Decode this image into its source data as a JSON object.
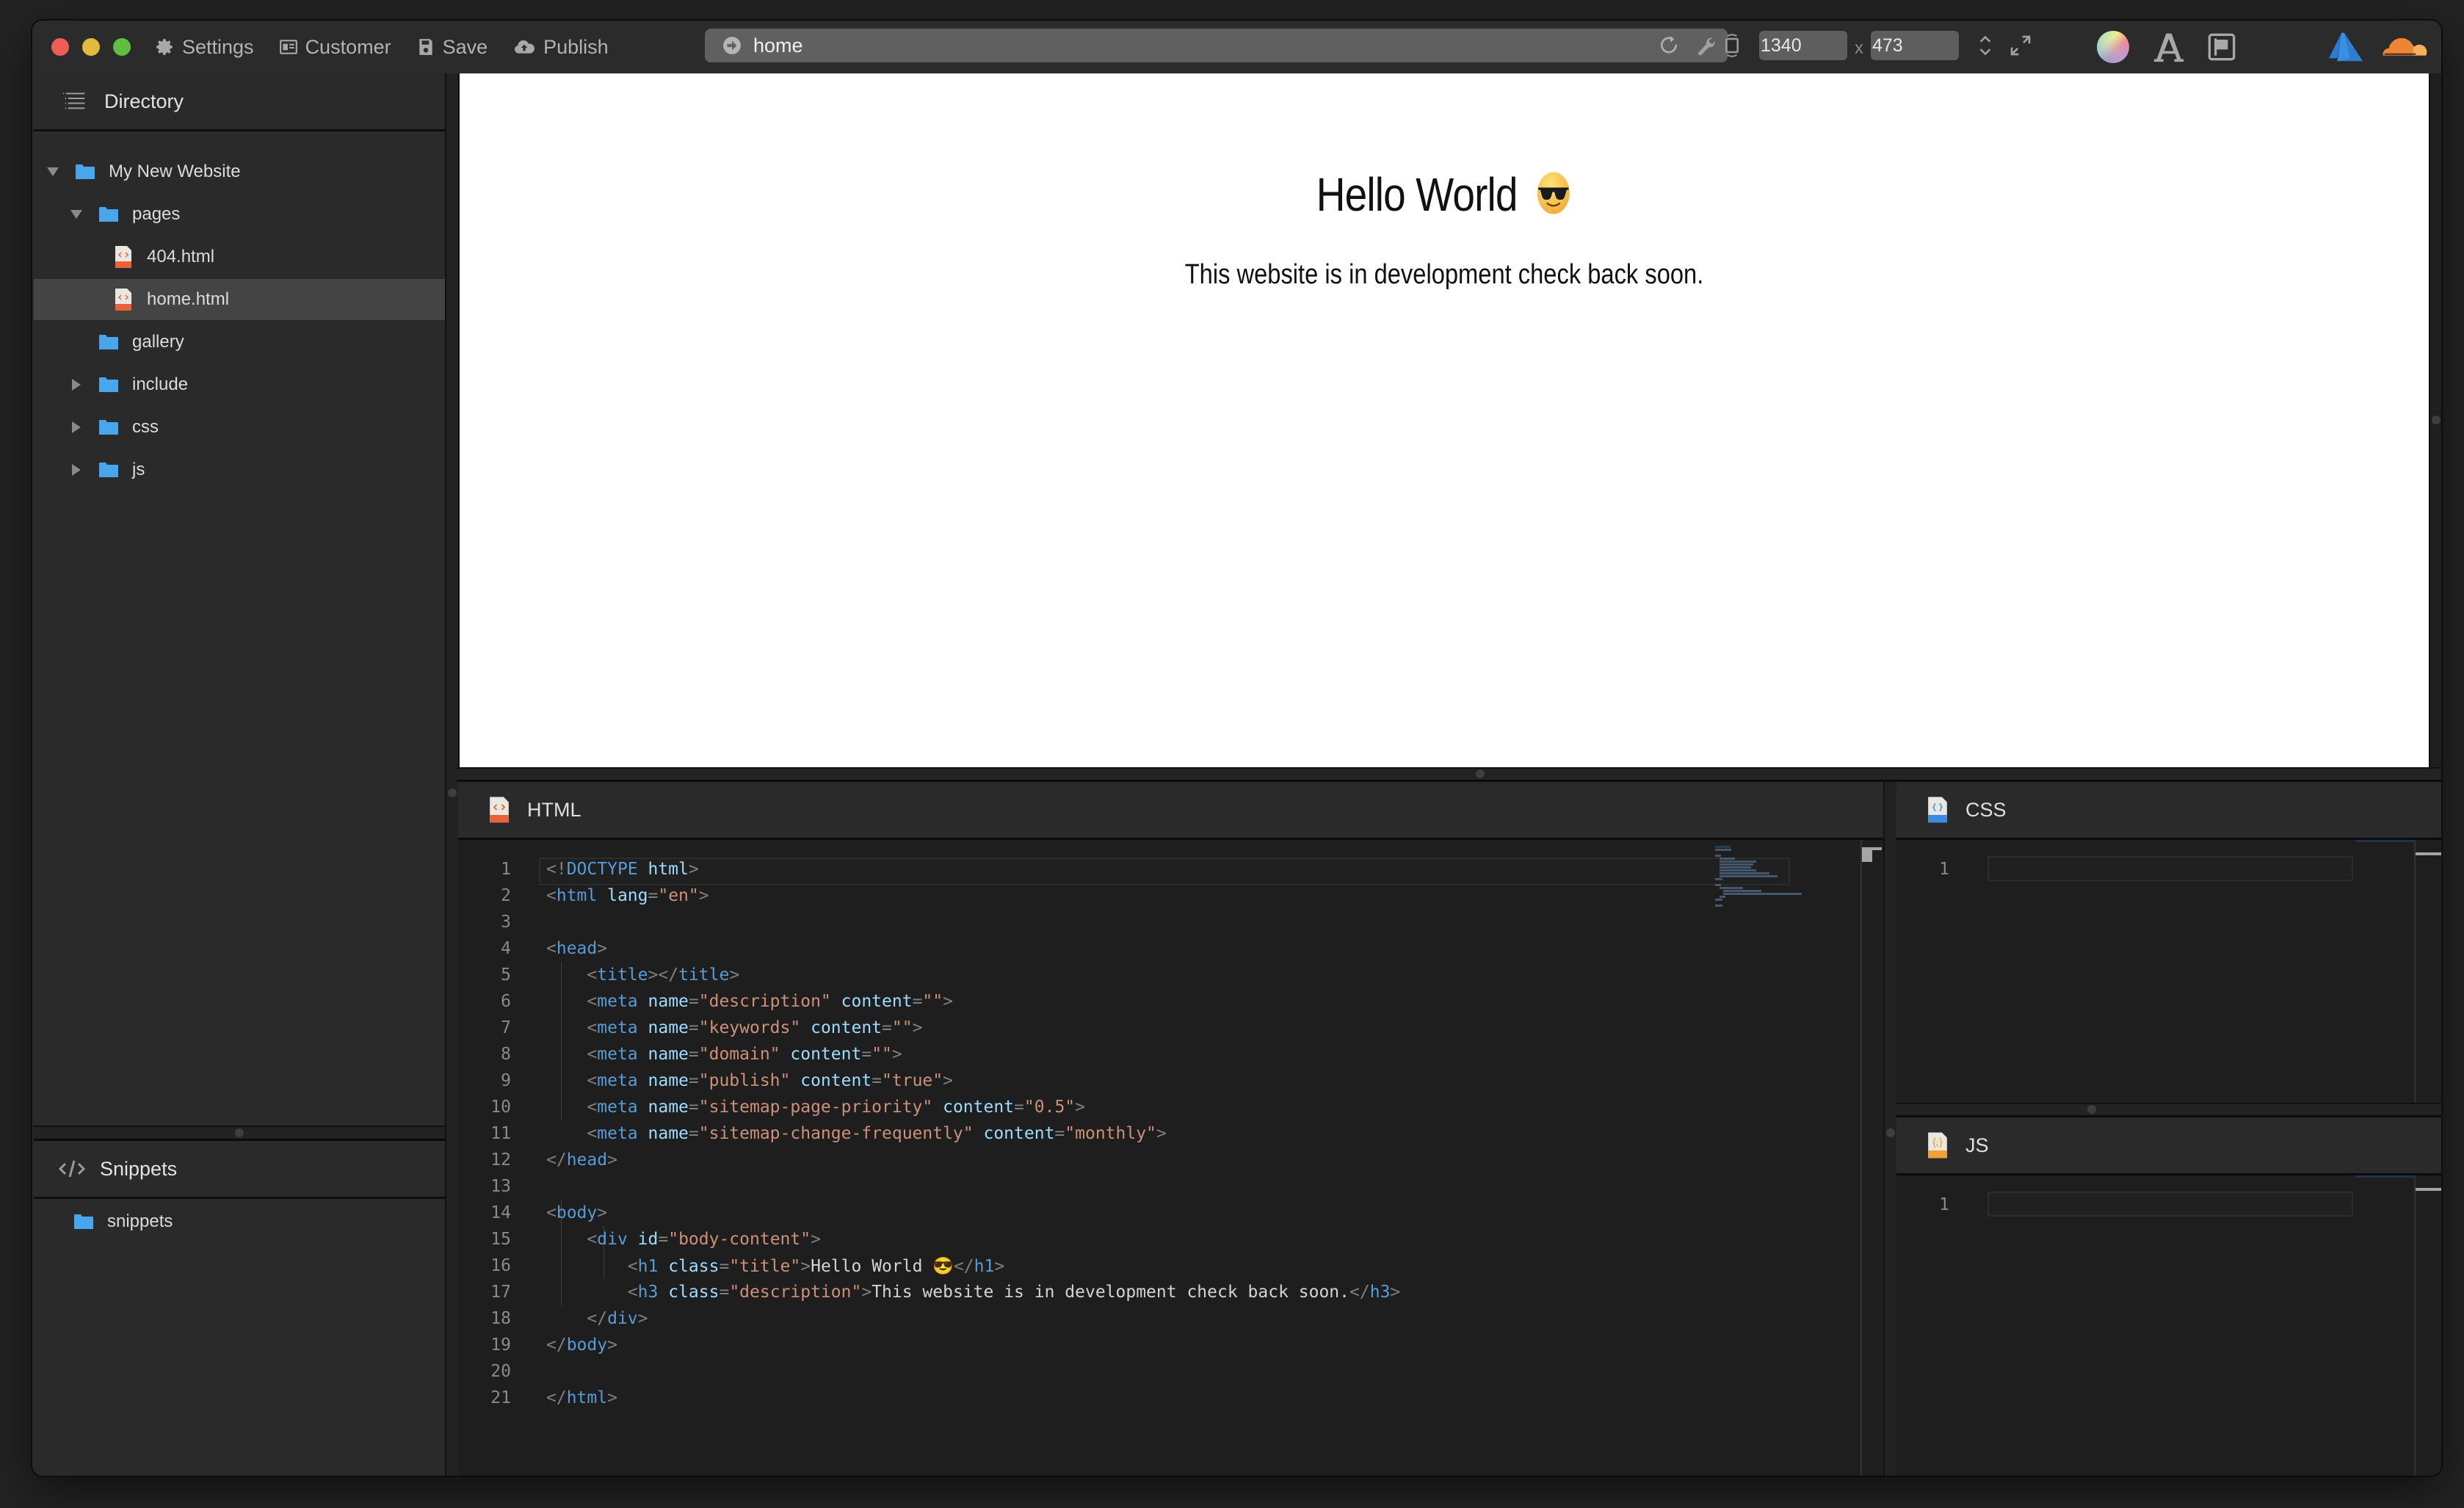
{
  "window": {
    "traffic_lights": {
      "close": "#ee5e56",
      "minimize": "#e1bb3d",
      "maximize": "#5fc040"
    }
  },
  "toolbar": {
    "buttons": [
      {
        "label": "Settings",
        "icon": "gear-icon"
      },
      {
        "label": "Customer",
        "icon": "id-card-icon"
      },
      {
        "label": "Save",
        "icon": "floppy-disk-icon"
      },
      {
        "label": "Publish",
        "icon": "cloud-upload-icon"
      }
    ],
    "url": {
      "value": "home",
      "icon": "arrow-circle-icon",
      "right_icons": [
        "reload-icon",
        "wrench-icon"
      ]
    },
    "viewport": {
      "width": "1340",
      "separator": "x",
      "height": "473"
    },
    "right_icons": [
      "rotate-device-icon",
      "stepper-icon",
      "expand-icon",
      "color-wheel-icon",
      "font-icon",
      "flag-icon",
      "azure-icon",
      "cloudflare-icon"
    ]
  },
  "sidebar": {
    "directory": {
      "title": "Directory",
      "items": [
        {
          "label": "My New Website",
          "type": "folder",
          "expanded": true,
          "level": 0
        },
        {
          "label": "pages",
          "type": "folder",
          "expanded": true,
          "level": 1
        },
        {
          "label": "404.html",
          "type": "file",
          "level": 2
        },
        {
          "label": "home.html",
          "type": "file",
          "level": 2,
          "selected": true
        },
        {
          "label": "gallery",
          "type": "folder",
          "level": 1
        },
        {
          "label": "include",
          "type": "folder",
          "expanded": false,
          "level": 1
        },
        {
          "label": "css",
          "type": "folder",
          "expanded": false,
          "level": 1
        },
        {
          "label": "js",
          "type": "folder",
          "expanded": false,
          "level": 1
        }
      ]
    },
    "snippets": {
      "title": "Snippets",
      "items": [
        {
          "label": "snippets",
          "type": "folder"
        }
      ]
    }
  },
  "preview": {
    "heading": "Hello World",
    "heading_emoji": "smiling-face-with-sunglasses",
    "description": "This website is in development check back soon."
  },
  "editors": {
    "html": {
      "title": "HTML",
      "lines": [
        "<!DOCTYPE html>",
        "<html lang=\"en\">",
        "",
        "<head>",
        "    <title></title>",
        "    <meta name=\"description\" content=\"\">",
        "    <meta name=\"keywords\" content=\"\">",
        "    <meta name=\"domain\" content=\"\">",
        "    <meta name=\"publish\" content=\"true\">",
        "    <meta name=\"sitemap-page-priority\" content=\"0.5\">",
        "    <meta name=\"sitemap-change-frequently\" content=\"monthly\">",
        "</head>",
        "",
        "<body>",
        "    <div id=\"body-content\">",
        "        <h1 class=\"title\">Hello World 😎</h1>",
        "        <h3 class=\"description\">This website is in development check back soon.</h3>",
        "    </div>",
        "</body>",
        "",
        "</html>"
      ]
    },
    "css": {
      "title": "CSS",
      "lines": [
        ""
      ]
    },
    "js": {
      "title": "JS",
      "lines": [
        ""
      ]
    }
  },
  "colors": {
    "folder": "#47a6ec",
    "html_badge": "#e8623a",
    "css_badge": "#3d8be0",
    "js_badge": "#eea23a",
    "tag": "#569cd6",
    "attr": "#9cdcfe",
    "string": "#ce9178",
    "punct": "#808080"
  }
}
